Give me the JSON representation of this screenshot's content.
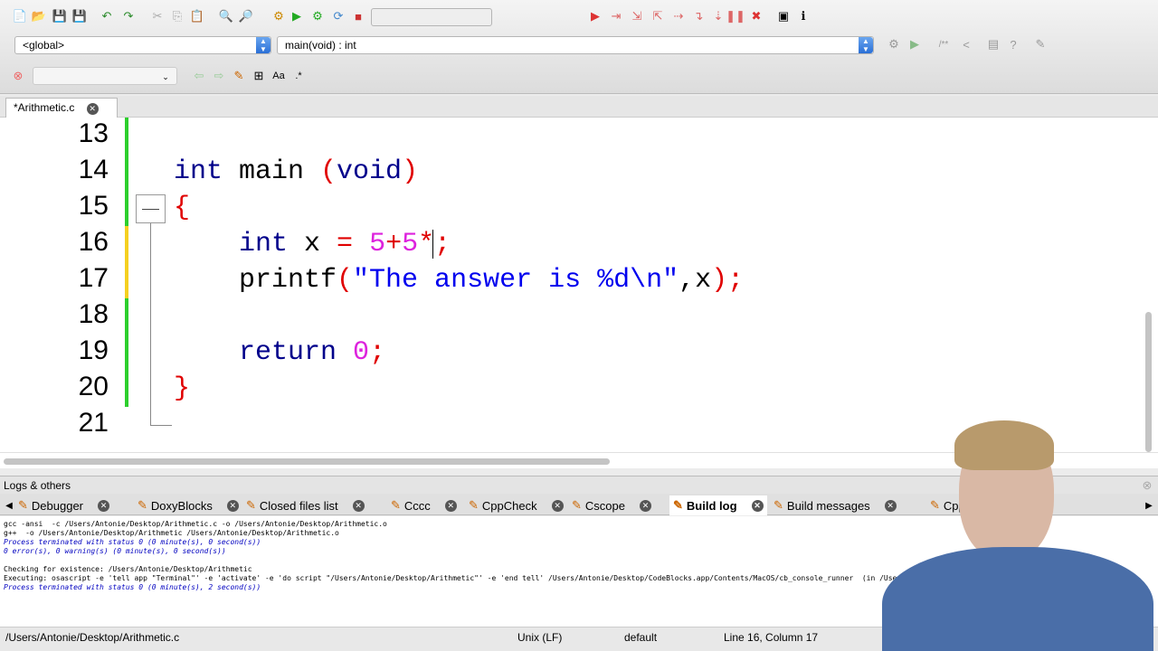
{
  "toolbar": {
    "scope_combo": "<global>",
    "function_combo": "main(void) : int"
  },
  "file_tab": {
    "label": "*Arithmetic.c"
  },
  "editor": {
    "line_numbers": [
      "13",
      "14",
      "15",
      "16",
      "17",
      "18",
      "19",
      "20",
      "21"
    ],
    "lines": [
      [],
      [
        [
          "kw",
          "int"
        ],
        [
          "",
          "main "
        ],
        [
          "op",
          "("
        ],
        [
          "kw",
          "void"
        ],
        [
          "op",
          ")"
        ]
      ],
      [
        [
          "op",
          "{"
        ]
      ],
      [
        [
          "",
          "    "
        ],
        [
          "kw",
          "int"
        ],
        [
          "",
          "x "
        ],
        [
          "op",
          "="
        ],
        [
          "",
          ""
        ],
        [
          "num",
          " 5"
        ],
        [
          "op",
          "+"
        ],
        [
          "num",
          "5"
        ],
        [
          "op",
          "*"
        ],
        [
          "op",
          ";"
        ]
      ],
      [
        [
          "",
          "    printf"
        ],
        [
          "op",
          "("
        ],
        [
          "str",
          "\"The answer is %d\\n\""
        ],
        [
          "",
          ",x"
        ],
        [
          "op",
          ")"
        ],
        [
          "op",
          ";"
        ]
      ],
      [],
      [
        [
          "",
          "    "
        ],
        [
          "kw",
          "return "
        ],
        [
          "num",
          "0"
        ],
        [
          "op",
          ";"
        ]
      ],
      [
        [
          "op",
          "}"
        ]
      ],
      []
    ]
  },
  "logs": {
    "title": "Logs & others",
    "tabs": [
      "Debugger",
      "DoxyBlocks",
      "Closed files list",
      "Cccc",
      "CppCheck",
      "Cscope",
      "Build log",
      "Build messages",
      "Cpp"
    ],
    "active_tab": "Build log",
    "lines": [
      {
        "t": "gcc -ansi  -c /Users/Antonie/Desktop/Arithmetic.c -o /Users/Antonie/Desktop/Arithmetic.o",
        "c": ""
      },
      {
        "t": "g++  -o /Users/Antonie/Desktop/Arithmetic /Users/Antonie/Desktop/Arithmetic.o",
        "c": ""
      },
      {
        "t": "Process terminated with status 0 (0 minute(s), 0 second(s))",
        "c": "blue"
      },
      {
        "t": "0 error(s), 0 warning(s) (0 minute(s), 0 second(s))",
        "c": "blue"
      },
      {
        "t": "",
        "c": ""
      },
      {
        "t": "Checking for existence: /Users/Antonie/Desktop/Arithmetic",
        "c": ""
      },
      {
        "t": "Executing: osascript -e 'tell app \"Terminal\"' -e 'activate' -e 'do script \"/Users/Antonie/Desktop/Arithmetic\"' -e 'end tell' /Users/Antonie/Desktop/CodeBlocks.app/Contents/MacOS/cb_console_runner  (in /Users/Antonie",
        "c": ""
      },
      {
        "t": "Process terminated with status 0 (0 minute(s), 2 second(s))",
        "c": "blue"
      }
    ]
  },
  "status": {
    "path": "/Users/Antonie/Desktop/Arithmetic.c",
    "eol": "Unix (LF)",
    "encoding": "default",
    "position": "Line 16, Column 17"
  }
}
